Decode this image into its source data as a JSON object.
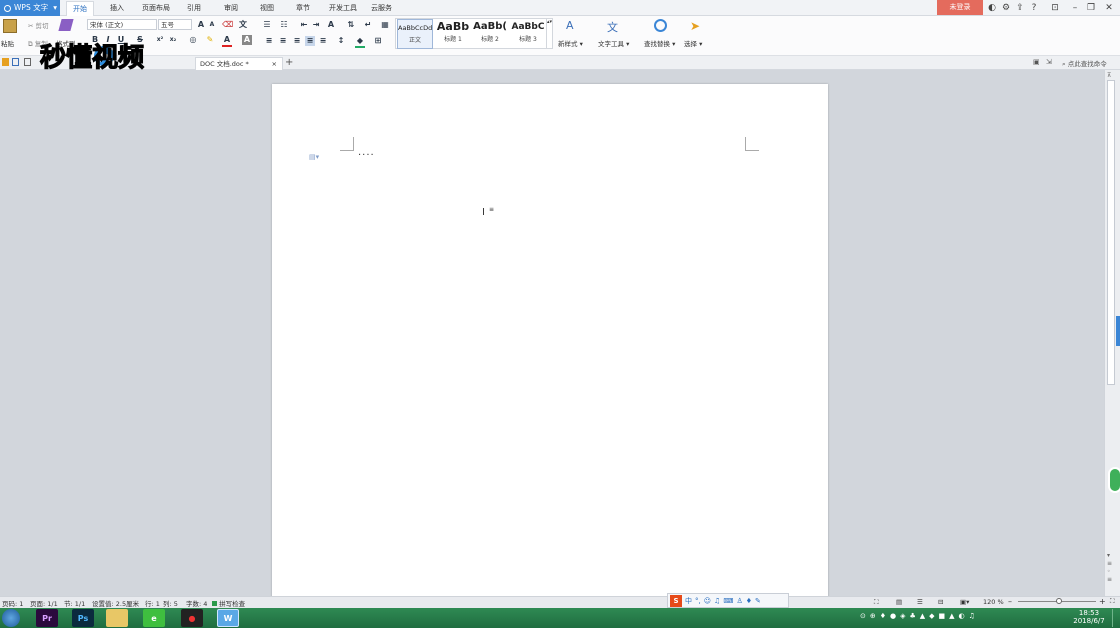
{
  "titlebar": {
    "app_button": "WPS 文字",
    "menu_tabs": [
      "开始",
      "插入",
      "页面布局",
      "引用",
      "审阅",
      "视图",
      "章节",
      "开发工具",
      "云服务"
    ],
    "login_button": "未登录"
  },
  "ribbon": {
    "paste_label": "粘贴",
    "cut_label": "剪切",
    "copy_label": "复制",
    "format_painter_label": "格式刷",
    "font_name": "宋体 (正文)",
    "font_size": "五号",
    "styles": [
      {
        "sample": "AaBbCcDd",
        "label": "正文"
      },
      {
        "sample": "AaBb",
        "label": "标题 1"
      },
      {
        "sample": "AaBb(",
        "label": "标题 2"
      },
      {
        "sample": "AaBbC",
        "label": "标题 3"
      }
    ],
    "new_style_label": "新样式",
    "text_tools_label": "文字工具",
    "find_replace_label": "查找替换",
    "select_label": "选择"
  },
  "doc_tabs": {
    "active_tab": "DOC 文档.doc *",
    "search_command": "点此查找命令"
  },
  "document": {
    "content_text": "····"
  },
  "statusbar": {
    "page_num": "页码: 1",
    "pages": "页面: 1/1",
    "section": "节: 1/1",
    "setting": "设置值: 2.5厘米",
    "row": "行: 1",
    "col": "列: 5",
    "word_count": "字数: 4",
    "spell_check": "拼写检查",
    "zoom": "120 %"
  },
  "ime": {
    "mode": "中"
  },
  "taskbar": {
    "apps": [
      "Pr",
      "Ps",
      "W"
    ],
    "time": "18:53",
    "date": "2018/6/7"
  },
  "watermark": {
    "text": "秒懂视频"
  },
  "colors": {
    "wps_blue": "#3b86d6",
    "login_red": "#e46b5d",
    "taskbar_green": "#2a7e4b",
    "page_bg": "#ffffff",
    "workspace_bg": "#d2d6dc"
  }
}
